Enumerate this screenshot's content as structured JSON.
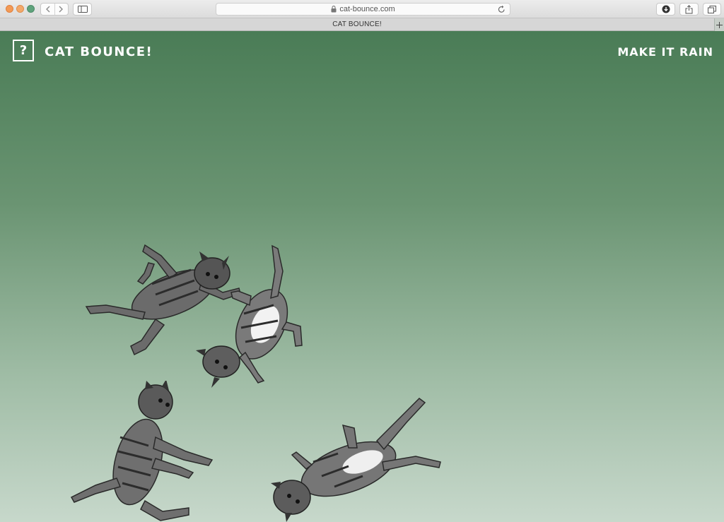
{
  "browser": {
    "url": "cat-bounce.com",
    "tab_title": "CAT BOUNCE!"
  },
  "site": {
    "help_label": "?",
    "title": "CAT BOUNCE!",
    "action_label": "MAKE IT RAIN"
  },
  "colors": {
    "bg_top": "#4a7c56",
    "bg_bottom": "#c7d8cb",
    "text": "#ffffff"
  },
  "cats": [
    {
      "name": "cat-top-left",
      "pose": "leaping-horizontal"
    },
    {
      "name": "cat-upside-down",
      "pose": "upside-down"
    },
    {
      "name": "cat-bottom-left",
      "pose": "standing-jump"
    },
    {
      "name": "cat-bottom-right",
      "pose": "diving"
    }
  ]
}
